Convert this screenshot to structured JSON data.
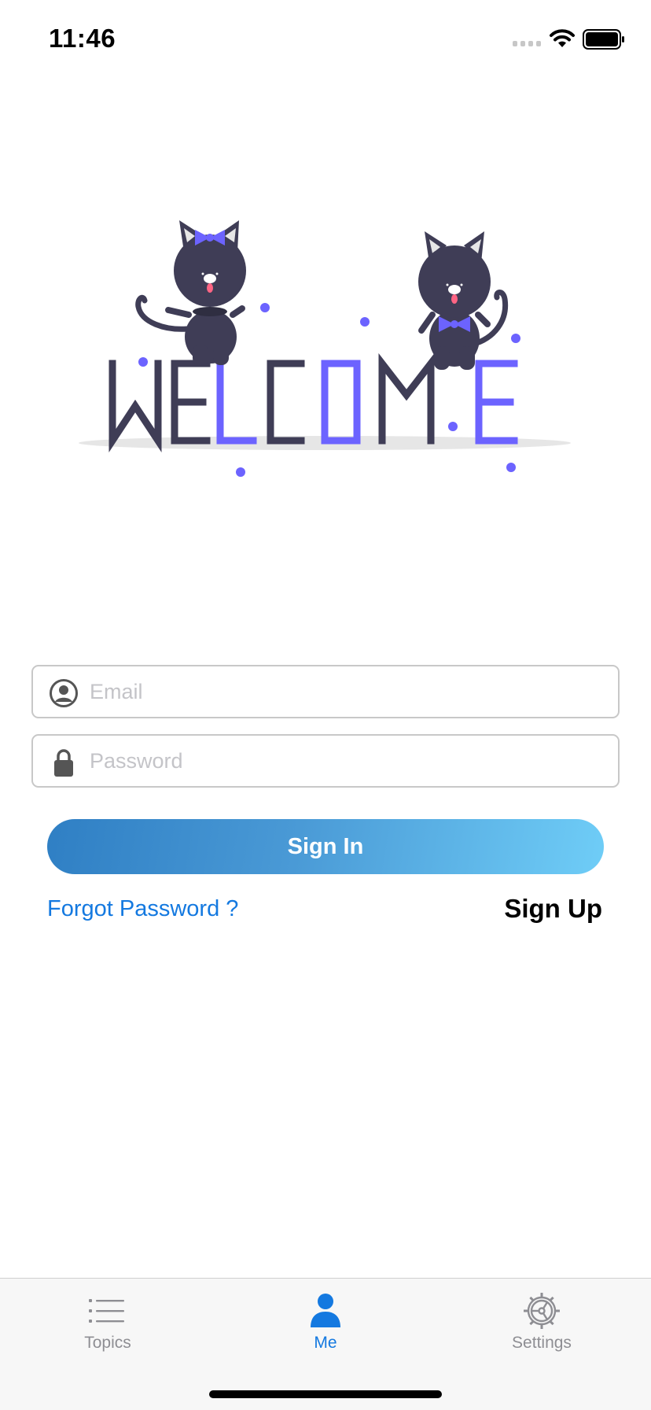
{
  "status_bar": {
    "time": "11:46",
    "signal_icon": "signal-icon",
    "wifi_icon": "wifi-icon",
    "battery_icon": "battery-icon"
  },
  "illustration": {
    "text": "WELCOME",
    "description_icon": "welcome-cats-illustration",
    "colors": {
      "dark": "#3f3d56",
      "accent": "#6c63ff",
      "shadow": "#e6e6e6"
    }
  },
  "login_form": {
    "email": {
      "placeholder": "Email",
      "value": "",
      "icon": "user-circle-icon"
    },
    "password": {
      "placeholder": "Password",
      "value": "",
      "icon": "lock-icon"
    },
    "sign_in_label": "Sign In",
    "forgot_password_label": "Forgot Password ?",
    "sign_up_label": "Sign Up"
  },
  "tab_bar": {
    "tabs": [
      {
        "label": "Topics",
        "icon": "list-icon",
        "selected": false
      },
      {
        "label": "Me",
        "icon": "person-icon",
        "selected": true
      },
      {
        "label": "Settings",
        "icon": "gear-icon",
        "selected": false
      }
    ],
    "selected_color": "#1479e0",
    "unselected_color": "#8e8e93"
  },
  "colors": {
    "link": "#1479e0",
    "button_gradient_start": "#2f7fc4",
    "button_gradient_end": "#6fcdf7"
  }
}
